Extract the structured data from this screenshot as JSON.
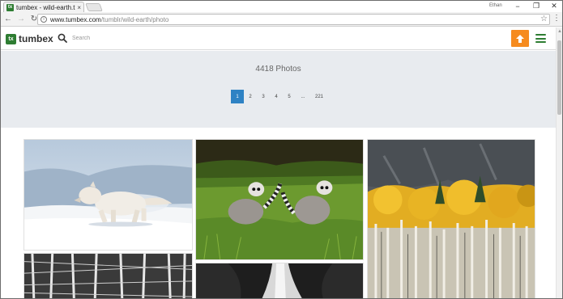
{
  "browser": {
    "tab_title": "tumbex - wild-earth.tumb",
    "tab_close": "×",
    "favicon_text": "tx",
    "profile_label": "Ethan",
    "url_host": "www.tumbex.com",
    "url_path": "/tumblr/wild-earth/photo",
    "window_controls": {
      "minimize": "−",
      "maximize": "❐",
      "close": "✕"
    }
  },
  "site": {
    "logo_mark": "tx",
    "logo_text": "tumbex",
    "search_placeholder": "Search",
    "accent_color": "#f68b1e",
    "brand_color": "#2e7d32"
  },
  "hero": {
    "photo_count": "4418 Photos"
  },
  "pagination": {
    "pages": [
      "1",
      "2",
      "3",
      "4",
      "5",
      "...",
      "221"
    ],
    "active": "1"
  },
  "photos": [
    {
      "subject": "arctic-wolf-in-snow"
    },
    {
      "subject": "ring-tailed-lemurs-on-grass"
    },
    {
      "subject": "golden-aspen-forest"
    },
    {
      "subject": "snowy-birch-trees"
    },
    {
      "subject": "waterfall"
    }
  ]
}
